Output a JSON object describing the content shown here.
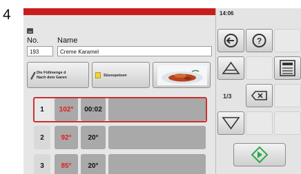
{
  "figure_number": "4",
  "status": {
    "time": "14:06"
  },
  "recipe": {
    "no_label": "No.",
    "name_label": "Name",
    "number": "193",
    "name": "Creme Karamel"
  },
  "options": {
    "fill_text_line1": "Die Füllmenge d",
    "fill_text_line2": "Nach dem Garen",
    "category": "Süssspeisen"
  },
  "steps": [
    {
      "num": "1",
      "temp": "102°",
      "time": "00:02",
      "temp_color": "#e21b1b",
      "time_color": "#111111"
    },
    {
      "num": "2",
      "temp": "92°",
      "time": "20°",
      "temp_color": "#e21b1b",
      "time_color": "#111111"
    },
    {
      "num": "3",
      "temp": "85°",
      "time": "20°",
      "temp_color": "#e21b1b",
      "time_color": "#111111"
    }
  ],
  "sidebar": {
    "page": "1/3"
  },
  "colors": {
    "accent_red": "#c91d1d",
    "start_green": "#2aa84a"
  }
}
